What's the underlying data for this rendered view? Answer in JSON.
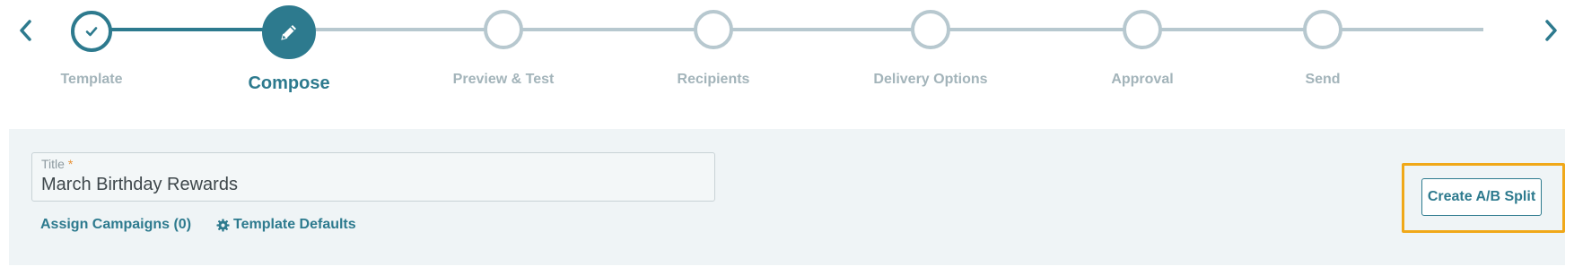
{
  "stepper": {
    "prev_icon": "chevron-left-icon",
    "next_icon": "chevron-right-icon",
    "steps": [
      {
        "label": "Template",
        "state": "done",
        "icon": "check-icon"
      },
      {
        "label": "Compose",
        "state": "current",
        "icon": "pencil-icon"
      },
      {
        "label": "Preview & Test",
        "state": "todo"
      },
      {
        "label": "Recipients",
        "state": "todo"
      },
      {
        "label": "Delivery Options",
        "state": "todo"
      },
      {
        "label": "Approval",
        "state": "todo"
      },
      {
        "label": "Send",
        "state": "todo"
      }
    ]
  },
  "compose": {
    "title_field": {
      "label": "Title",
      "required_marker": "*",
      "value": "March Birthday Rewards"
    },
    "assign_campaigns_label": "Assign Campaigns (0)",
    "template_defaults_label": "Template Defaults",
    "template_defaults_icon": "gear-icon",
    "ab_split_label": "Create A/B Split"
  },
  "colors": {
    "accent": "#2d7a8e",
    "inactive": "#b7c8cf",
    "panel_bg": "#eff4f6",
    "highlight": "#f0a819",
    "required": "#e8943a"
  }
}
